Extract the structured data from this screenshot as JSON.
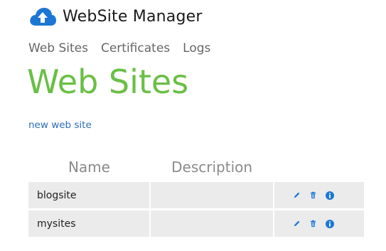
{
  "app": {
    "title": "WebSite Manager"
  },
  "nav": [
    {
      "label": "Web Sites"
    },
    {
      "label": "Certificates"
    },
    {
      "label": "Logs"
    }
  ],
  "page": {
    "title": "Web Sites",
    "new_link": "new web site"
  },
  "table": {
    "columns": [
      "Name",
      "Description"
    ],
    "rows": [
      {
        "name": "blogsite",
        "description": ""
      },
      {
        "name": "mysites",
        "description": ""
      }
    ]
  },
  "icons": {
    "logo": "cloud-upload-icon",
    "edit": "pencil-icon",
    "delete": "trash-icon",
    "info": "info-icon"
  },
  "colors": {
    "title_green": "#6abf45",
    "link_blue": "#2b6cb8",
    "logo_blue": "#1c77d4",
    "row_gray": "#ebebeb"
  }
}
